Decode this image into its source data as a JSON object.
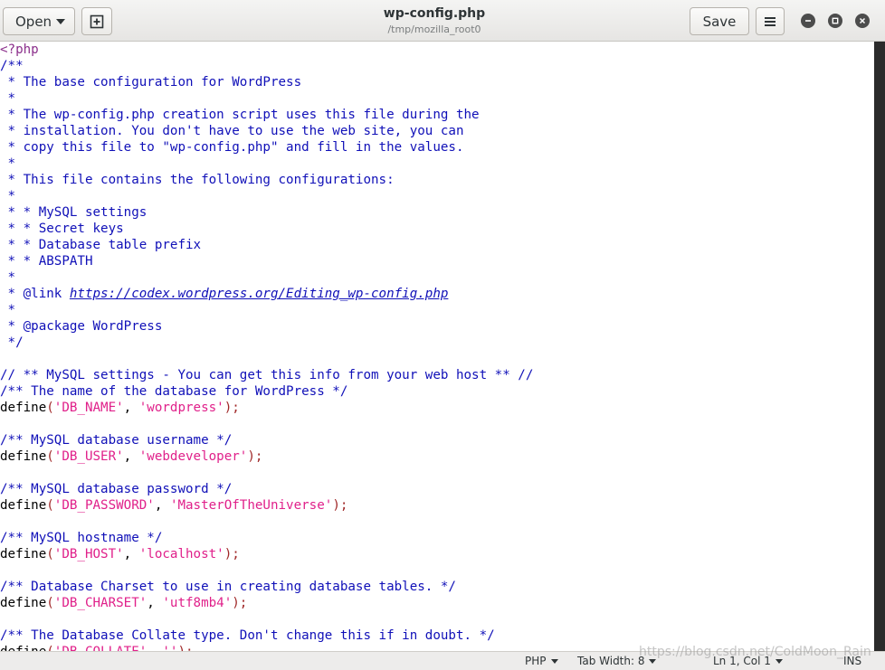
{
  "window": {
    "title": "wp-config.php",
    "subtitle": "/tmp/mozilla_root0"
  },
  "headerbar": {
    "open_label": "Open",
    "save_label": "Save"
  },
  "editor": {
    "lines": [
      [
        {
          "t": "<?php",
          "c": "p"
        }
      ],
      [
        {
          "t": "/**",
          "c": "c"
        }
      ],
      [
        {
          "t": " * The base configuration for WordPress",
          "c": "c"
        }
      ],
      [
        {
          "t": " *",
          "c": "c"
        }
      ],
      [
        {
          "t": " * The wp-config.php creation script uses this file during the",
          "c": "c"
        }
      ],
      [
        {
          "t": " * installation. You don't have to use the web site, you can",
          "c": "c"
        }
      ],
      [
        {
          "t": " * copy this file to \"wp-config.php\" and fill in the values.",
          "c": "c"
        }
      ],
      [
        {
          "t": " *",
          "c": "c"
        }
      ],
      [
        {
          "t": " * This file contains the following configurations:",
          "c": "c"
        }
      ],
      [
        {
          "t": " *",
          "c": "c"
        }
      ],
      [
        {
          "t": " * * MySQL settings",
          "c": "c"
        }
      ],
      [
        {
          "t": " * * Secret keys",
          "c": "c"
        }
      ],
      [
        {
          "t": " * * Database table prefix",
          "c": "c"
        }
      ],
      [
        {
          "t": " * * ABSPATH",
          "c": "c"
        }
      ],
      [
        {
          "t": " *",
          "c": "c"
        }
      ],
      [
        {
          "t": " * @link ",
          "c": "c"
        },
        {
          "t": "https://codex.wordpress.org/Editing_wp-config.php",
          "c": "c u"
        }
      ],
      [
        {
          "t": " *",
          "c": "c"
        }
      ],
      [
        {
          "t": " * @package WordPress",
          "c": "c"
        }
      ],
      [
        {
          "t": " */",
          "c": "c"
        }
      ],
      [
        {
          "t": "",
          "c": "k"
        }
      ],
      [
        {
          "t": "// ** MySQL settings - You can get this info from your web host ** //",
          "c": "c"
        }
      ],
      [
        {
          "t": "/** The name of the database for WordPress */",
          "c": "c"
        }
      ],
      [
        {
          "t": "define",
          "c": "k"
        },
        {
          "t": "(",
          "c": "br"
        },
        {
          "t": "'DB_NAME'",
          "c": "s"
        },
        {
          "t": ", ",
          "c": "k"
        },
        {
          "t": "'wordpress'",
          "c": "s"
        },
        {
          "t": ");",
          "c": "br"
        }
      ],
      [
        {
          "t": "",
          "c": "k"
        }
      ],
      [
        {
          "t": "/** MySQL database username */",
          "c": "c"
        }
      ],
      [
        {
          "t": "define",
          "c": "k"
        },
        {
          "t": "(",
          "c": "br"
        },
        {
          "t": "'DB_USER'",
          "c": "s"
        },
        {
          "t": ", ",
          "c": "k"
        },
        {
          "t": "'webdeveloper'",
          "c": "s"
        },
        {
          "t": ");",
          "c": "br"
        }
      ],
      [
        {
          "t": "",
          "c": "k"
        }
      ],
      [
        {
          "t": "/** MySQL database password */",
          "c": "c"
        }
      ],
      [
        {
          "t": "define",
          "c": "k"
        },
        {
          "t": "(",
          "c": "br"
        },
        {
          "t": "'DB_PASSWORD'",
          "c": "s"
        },
        {
          "t": ", ",
          "c": "k"
        },
        {
          "t": "'MasterOfTheUniverse'",
          "c": "s"
        },
        {
          "t": ");",
          "c": "br"
        }
      ],
      [
        {
          "t": "",
          "c": "k"
        }
      ],
      [
        {
          "t": "/** MySQL hostname */",
          "c": "c"
        }
      ],
      [
        {
          "t": "define",
          "c": "k"
        },
        {
          "t": "(",
          "c": "br"
        },
        {
          "t": "'DB_HOST'",
          "c": "s"
        },
        {
          "t": ", ",
          "c": "k"
        },
        {
          "t": "'localhost'",
          "c": "s"
        },
        {
          "t": ");",
          "c": "br"
        }
      ],
      [
        {
          "t": "",
          "c": "k"
        }
      ],
      [
        {
          "t": "/** Database Charset to use in creating database tables. */",
          "c": "c"
        }
      ],
      [
        {
          "t": "define",
          "c": "k"
        },
        {
          "t": "(",
          "c": "br"
        },
        {
          "t": "'DB_CHARSET'",
          "c": "s"
        },
        {
          "t": ", ",
          "c": "k"
        },
        {
          "t": "'utf8mb4'",
          "c": "s"
        },
        {
          "t": ");",
          "c": "br"
        }
      ],
      [
        {
          "t": "",
          "c": "k"
        }
      ],
      [
        {
          "t": "/** The Database Collate type. Don't change this if in doubt. */",
          "c": "c"
        }
      ],
      [
        {
          "t": "define",
          "c": "k"
        },
        {
          "t": "(",
          "c": "br"
        },
        {
          "t": "'DB_COLLATE'",
          "c": "s"
        },
        {
          "t": ", ",
          "c": "k"
        },
        {
          "t": "''",
          "c": "s"
        },
        {
          "t": ");",
          "c": "br"
        }
      ]
    ]
  },
  "statusbar": {
    "language": "PHP",
    "tab_width": "Tab Width: 8",
    "position": "Ln 1, Col 1",
    "mode": "INS"
  },
  "watermark": "https://blog.csdn.net/ColdMoon_Rain",
  "colors": {
    "comment": "#1010b8",
    "string": "#e0208a",
    "php_tag": "#8b2f8b"
  },
  "icons": {
    "new_tab": "new-tab-icon",
    "menu": "hamburger-menu-icon",
    "minimize": "minimize-icon",
    "maximize": "maximize-icon",
    "close": "close-icon"
  }
}
